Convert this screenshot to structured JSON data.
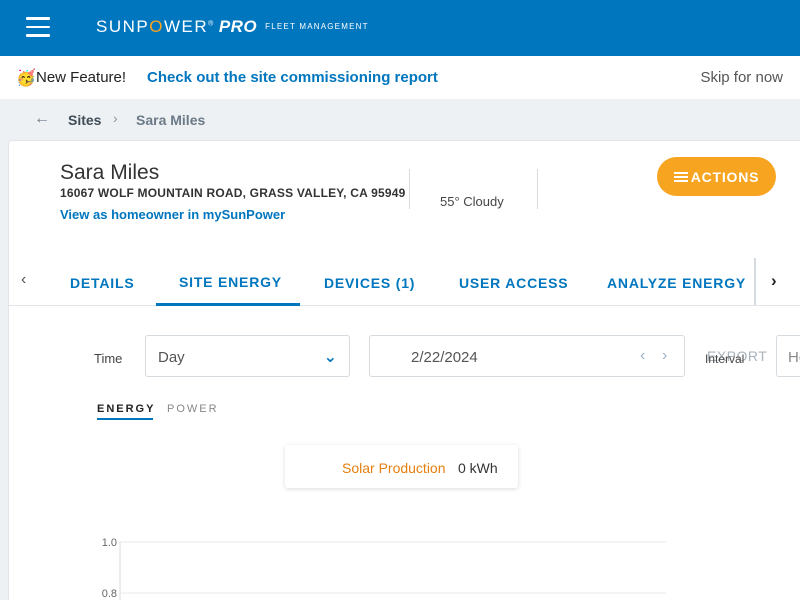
{
  "header": {
    "logo_brand_pre": "SUNP",
    "logo_brand_o": "O",
    "logo_brand_post": "WER",
    "logo_reg": "®",
    "logo_pro": "PRO",
    "logo_sub": "FLEET MANAGEMENT"
  },
  "feature_banner": {
    "emoji": "🥳",
    "label": "New Feature!",
    "link": "Check out the site commissioning report",
    "skip": "Skip for now"
  },
  "breadcrumb": {
    "sites": "Sites",
    "current": "Sara Miles"
  },
  "site": {
    "name": "Sara Miles",
    "address": "16067 WOLF MOUNTAIN ROAD, GRASS VALLEY, CA 95949",
    "homeowner_link": "View as homeowner in mySunPower",
    "weather": "55° Cloudy",
    "actions_label": "ACTIONS"
  },
  "tabs": [
    {
      "label": "DETAILS",
      "active": false
    },
    {
      "label": "SITE ENERGY",
      "active": true
    },
    {
      "label": "DEVICES (1)",
      "active": false
    },
    {
      "label": "USER ACCESS",
      "active": false
    },
    {
      "label": "ANALYZE ENERGY",
      "active": false
    }
  ],
  "controls": {
    "time_label": "Time",
    "time_value": "Day",
    "date_value": "2/22/2024",
    "export_label": "EXPORT",
    "interval_label": "Interval",
    "interval_value": "Ho"
  },
  "subtabs": {
    "energy": "ENERGY",
    "power": "POWER",
    "active": "energy"
  },
  "summary": {
    "label": "Solar Production",
    "value": "0 kWh"
  },
  "colors": {
    "brand_blue": "#0076be",
    "accent_orange": "#f7a521",
    "solar_label": "#e57f0e"
  },
  "chart_data": {
    "type": "line",
    "title": "",
    "xlabel": "",
    "ylabel": "",
    "yticks": [
      "1.0",
      "0.8"
    ],
    "ylim": [
      0.8,
      1.0
    ],
    "series": [],
    "grid": true
  }
}
